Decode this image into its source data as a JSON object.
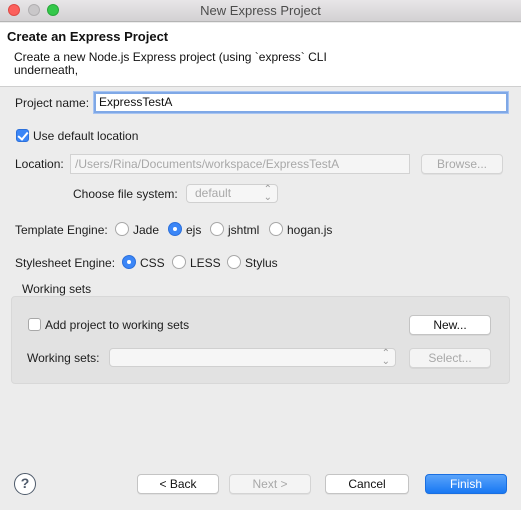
{
  "window": {
    "title": "New Express Project"
  },
  "banner": {
    "title": "Create an Express Project",
    "description": "Create a new Node.js Express project (using `express` CLI underneath,"
  },
  "project": {
    "name_label": "Project name:",
    "name_value": "ExpressTestA",
    "use_default_label": "Use default location",
    "location_label": "Location:",
    "location_value": "/Users/Rina/Documents/workspace/ExpressTestA",
    "browse_label": "Browse...",
    "filesystem_label": "Choose file system:",
    "filesystem_value": "default"
  },
  "template_engine": {
    "label": "Template Engine:",
    "options": [
      "Jade",
      "ejs",
      "jshtml",
      "hogan.js"
    ],
    "selected": "ejs"
  },
  "stylesheet_engine": {
    "label": "Stylesheet Engine:",
    "options": [
      "CSS",
      "LESS",
      "Stylus"
    ],
    "selected": "CSS"
  },
  "working_sets": {
    "group_label": "Working sets",
    "add_label": "Add project to working sets",
    "new_label": "New...",
    "sets_label": "Working sets:",
    "select_label": "Select..."
  },
  "footer": {
    "back_label": "< Back",
    "next_label": "Next >",
    "cancel_label": "Cancel",
    "finish_label": "Finish",
    "help_glyph": "?"
  },
  "colors": {
    "accent": "#3b86f7",
    "finish_button": "#1878f3",
    "close_light": "#fc605c",
    "zoom_light": "#34c84a"
  }
}
